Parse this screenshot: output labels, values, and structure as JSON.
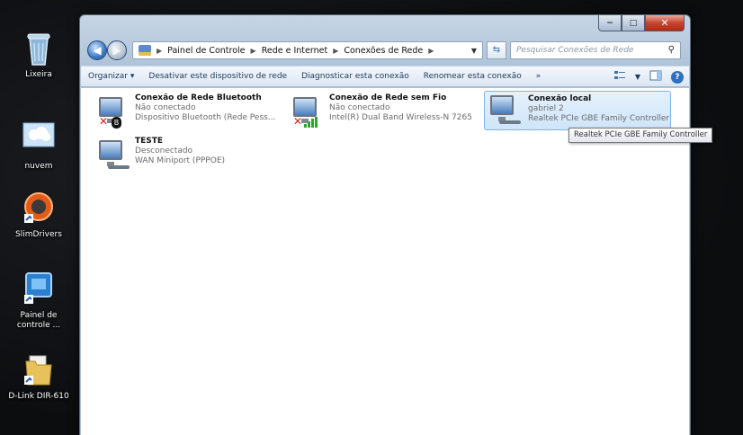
{
  "desktop": {
    "icons": [
      {
        "label": "Lixeira",
        "icon": "recycle-bin-icon"
      },
      {
        "label": "nuvem",
        "icon": "cloud-icon"
      },
      {
        "label": "SlimDrivers",
        "icon": "slimdrivers-icon"
      },
      {
        "label": "Painel de controle ...",
        "icon": "control-panel-shortcut-icon"
      },
      {
        "label": "D-Link DIR-610",
        "icon": "folder-icon"
      }
    ]
  },
  "window": {
    "caption_buttons": [
      "−",
      "□",
      "✕"
    ],
    "breadcrumb": [
      "Painel de Controle",
      "Rede e Internet",
      "Conexões de Rede"
    ],
    "search_placeholder": "Pesquisar Conexões de Rede",
    "toolbar": {
      "organize": "Organizar ▾",
      "disable": "Desativar este dispositivo de rede",
      "diagnose": "Diagnosticar esta conexão",
      "rename": "Renomear esta conexão",
      "more": "»"
    },
    "connections": [
      {
        "name": "Conexão de Rede Bluetooth",
        "status": "Não conectado",
        "device": "Dispositivo Bluetooth (Rede Pess...",
        "icon": "bluetooth-network-icon"
      },
      {
        "name": "Conexão de Rede sem Fio",
        "status": "Não conectado",
        "device": "Intel(R) Dual Band Wireless-N 7265",
        "icon": "wireless-network-icon"
      },
      {
        "name": "Conexão local",
        "status": "gabriel 2",
        "device": "Realtek PCIe GBE Family Controller",
        "icon": "lan-network-icon",
        "selected": true
      },
      {
        "name": "TESTE",
        "status": "Desconectado",
        "device": "WAN Miniport (PPPOE)",
        "icon": "pppoe-network-icon"
      }
    ],
    "tooltip": "Realtek PCIe GBE Family Controller"
  },
  "colors": {
    "selection": "#cfe5fa",
    "error_red": "#d42020",
    "signal_green": "#2fa52b"
  }
}
